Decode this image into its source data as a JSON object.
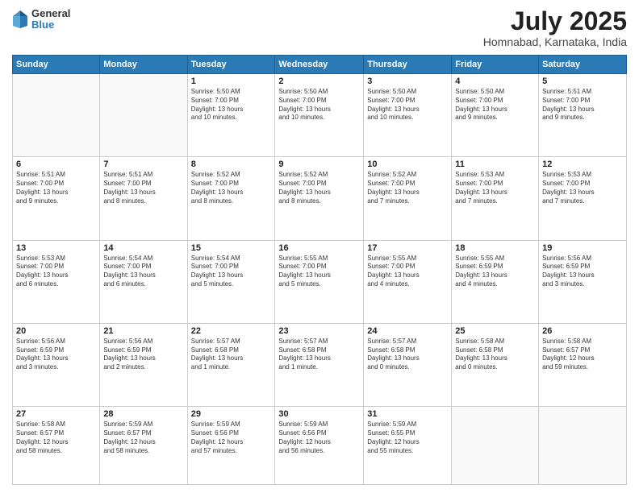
{
  "header": {
    "logo_line1": "General",
    "logo_line2": "Blue",
    "month": "July 2025",
    "location": "Homnabad, Karnataka, India"
  },
  "days_of_week": [
    "Sunday",
    "Monday",
    "Tuesday",
    "Wednesday",
    "Thursday",
    "Friday",
    "Saturday"
  ],
  "weeks": [
    [
      {
        "day": "",
        "text": ""
      },
      {
        "day": "",
        "text": ""
      },
      {
        "day": "1",
        "text": "Sunrise: 5:50 AM\nSunset: 7:00 PM\nDaylight: 13 hours\nand 10 minutes."
      },
      {
        "day": "2",
        "text": "Sunrise: 5:50 AM\nSunset: 7:00 PM\nDaylight: 13 hours\nand 10 minutes."
      },
      {
        "day": "3",
        "text": "Sunrise: 5:50 AM\nSunset: 7:00 PM\nDaylight: 13 hours\nand 10 minutes."
      },
      {
        "day": "4",
        "text": "Sunrise: 5:50 AM\nSunset: 7:00 PM\nDaylight: 13 hours\nand 9 minutes."
      },
      {
        "day": "5",
        "text": "Sunrise: 5:51 AM\nSunset: 7:00 PM\nDaylight: 13 hours\nand 9 minutes."
      }
    ],
    [
      {
        "day": "6",
        "text": "Sunrise: 5:51 AM\nSunset: 7:00 PM\nDaylight: 13 hours\nand 9 minutes."
      },
      {
        "day": "7",
        "text": "Sunrise: 5:51 AM\nSunset: 7:00 PM\nDaylight: 13 hours\nand 8 minutes."
      },
      {
        "day": "8",
        "text": "Sunrise: 5:52 AM\nSunset: 7:00 PM\nDaylight: 13 hours\nand 8 minutes."
      },
      {
        "day": "9",
        "text": "Sunrise: 5:52 AM\nSunset: 7:00 PM\nDaylight: 13 hours\nand 8 minutes."
      },
      {
        "day": "10",
        "text": "Sunrise: 5:52 AM\nSunset: 7:00 PM\nDaylight: 13 hours\nand 7 minutes."
      },
      {
        "day": "11",
        "text": "Sunrise: 5:53 AM\nSunset: 7:00 PM\nDaylight: 13 hours\nand 7 minutes."
      },
      {
        "day": "12",
        "text": "Sunrise: 5:53 AM\nSunset: 7:00 PM\nDaylight: 13 hours\nand 7 minutes."
      }
    ],
    [
      {
        "day": "13",
        "text": "Sunrise: 5:53 AM\nSunset: 7:00 PM\nDaylight: 13 hours\nand 6 minutes."
      },
      {
        "day": "14",
        "text": "Sunrise: 5:54 AM\nSunset: 7:00 PM\nDaylight: 13 hours\nand 6 minutes."
      },
      {
        "day": "15",
        "text": "Sunrise: 5:54 AM\nSunset: 7:00 PM\nDaylight: 13 hours\nand 5 minutes."
      },
      {
        "day": "16",
        "text": "Sunrise: 5:55 AM\nSunset: 7:00 PM\nDaylight: 13 hours\nand 5 minutes."
      },
      {
        "day": "17",
        "text": "Sunrise: 5:55 AM\nSunset: 7:00 PM\nDaylight: 13 hours\nand 4 minutes."
      },
      {
        "day": "18",
        "text": "Sunrise: 5:55 AM\nSunset: 6:59 PM\nDaylight: 13 hours\nand 4 minutes."
      },
      {
        "day": "19",
        "text": "Sunrise: 5:56 AM\nSunset: 6:59 PM\nDaylight: 13 hours\nand 3 minutes."
      }
    ],
    [
      {
        "day": "20",
        "text": "Sunrise: 5:56 AM\nSunset: 6:59 PM\nDaylight: 13 hours\nand 3 minutes."
      },
      {
        "day": "21",
        "text": "Sunrise: 5:56 AM\nSunset: 6:59 PM\nDaylight: 13 hours\nand 2 minutes."
      },
      {
        "day": "22",
        "text": "Sunrise: 5:57 AM\nSunset: 6:58 PM\nDaylight: 13 hours\nand 1 minute."
      },
      {
        "day": "23",
        "text": "Sunrise: 5:57 AM\nSunset: 6:58 PM\nDaylight: 13 hours\nand 1 minute."
      },
      {
        "day": "24",
        "text": "Sunrise: 5:57 AM\nSunset: 6:58 PM\nDaylight: 13 hours\nand 0 minutes."
      },
      {
        "day": "25",
        "text": "Sunrise: 5:58 AM\nSunset: 6:58 PM\nDaylight: 13 hours\nand 0 minutes."
      },
      {
        "day": "26",
        "text": "Sunrise: 5:58 AM\nSunset: 6:57 PM\nDaylight: 12 hours\nand 59 minutes."
      }
    ],
    [
      {
        "day": "27",
        "text": "Sunrise: 5:58 AM\nSunset: 6:57 PM\nDaylight: 12 hours\nand 58 minutes."
      },
      {
        "day": "28",
        "text": "Sunrise: 5:59 AM\nSunset: 6:57 PM\nDaylight: 12 hours\nand 58 minutes."
      },
      {
        "day": "29",
        "text": "Sunrise: 5:59 AM\nSunset: 6:56 PM\nDaylight: 12 hours\nand 57 minutes."
      },
      {
        "day": "30",
        "text": "Sunrise: 5:59 AM\nSunset: 6:56 PM\nDaylight: 12 hours\nand 56 minutes."
      },
      {
        "day": "31",
        "text": "Sunrise: 5:59 AM\nSunset: 6:55 PM\nDaylight: 12 hours\nand 55 minutes."
      },
      {
        "day": "",
        "text": ""
      },
      {
        "day": "",
        "text": ""
      }
    ]
  ]
}
